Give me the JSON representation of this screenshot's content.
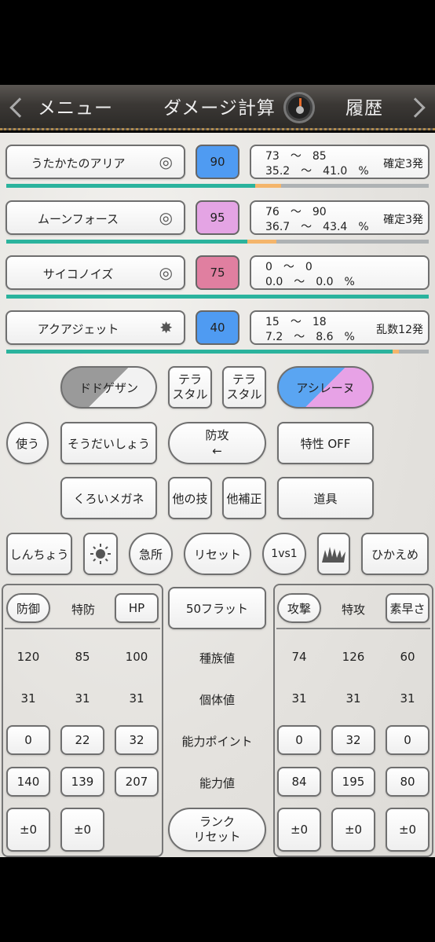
{
  "header": {
    "back_label": "メニュー",
    "title": "ダメージ計算",
    "history_label": "履歴"
  },
  "moves": [
    {
      "name": "うたかたのアリア",
      "power": "90",
      "power_color": "#4f9bf2",
      "dmg": "73　～　85",
      "pct": "35.2　～　41.0　%",
      "verdict": "確定3発",
      "hp_remaining": 0.59,
      "hp_range": 0.06
    },
    {
      "name": "ムーンフォース",
      "power": "95",
      "power_color": "#e4a4e4",
      "dmg": "76　～　90",
      "pct": "36.7　～　43.4　%",
      "verdict": "確定3発",
      "hp_remaining": 0.57,
      "hp_range": 0.07
    },
    {
      "name": "サイコノイズ",
      "power": "75",
      "power_color": "#e07fa0",
      "dmg": "0　～　0",
      "pct": "0.0　～　0.0　%",
      "verdict": "",
      "hp_remaining": 1.0,
      "hp_range": 0
    },
    {
      "name": "アクアジェット",
      "power": "40",
      "power_color": "#4f9bf2",
      "dmg": "15　～　18",
      "pct": "7.2　～　8.6　%",
      "verdict": "乱数12発",
      "hp_remaining": 0.915,
      "hp_range": 0.015
    }
  ],
  "defender": {
    "name": "ドドゲザン"
  },
  "attacker": {
    "name": "アシレーヌ"
  },
  "tera_label": "テラ\nスタル",
  "buttons": {
    "use": "使う",
    "held_item_def": "そうだいしょう",
    "swap": "防攻\n←",
    "ability": "特性 OFF",
    "item_atk": "くろいメガネ",
    "other_move": "他の技",
    "other_mod": "他補正",
    "item": "道具",
    "shinchou": "しんちょう",
    "crit": "急所",
    "reset": "リセット",
    "vs": "1vs1",
    "hikaeme": "ひかえめ",
    "flat50": "50フラット",
    "rank_reset": "ランク\nリセット"
  },
  "left_panel": {
    "headers": [
      "防御",
      "特防",
      "HP"
    ],
    "base": [
      "120",
      "85",
      "100"
    ],
    "iv": [
      "31",
      "31",
      "31"
    ],
    "ev": [
      "0",
      "22",
      "32"
    ],
    "stat": [
      "140",
      "139",
      "207"
    ],
    "rank": [
      "±0",
      "±0"
    ]
  },
  "right_panel": {
    "headers": [
      "攻撃",
      "特攻",
      "素早さ"
    ],
    "base": [
      "74",
      "126",
      "60"
    ],
    "iv": [
      "31",
      "31",
      "31"
    ],
    "ev": [
      "0",
      "32",
      "0"
    ],
    "stat": [
      "84",
      "195",
      "80"
    ],
    "rank": [
      "±0",
      "±0",
      "±0"
    ]
  },
  "center_labels": {
    "base": "種族値",
    "iv": "個体値",
    "ev": "能力ポイント",
    "stat": "能力値"
  }
}
